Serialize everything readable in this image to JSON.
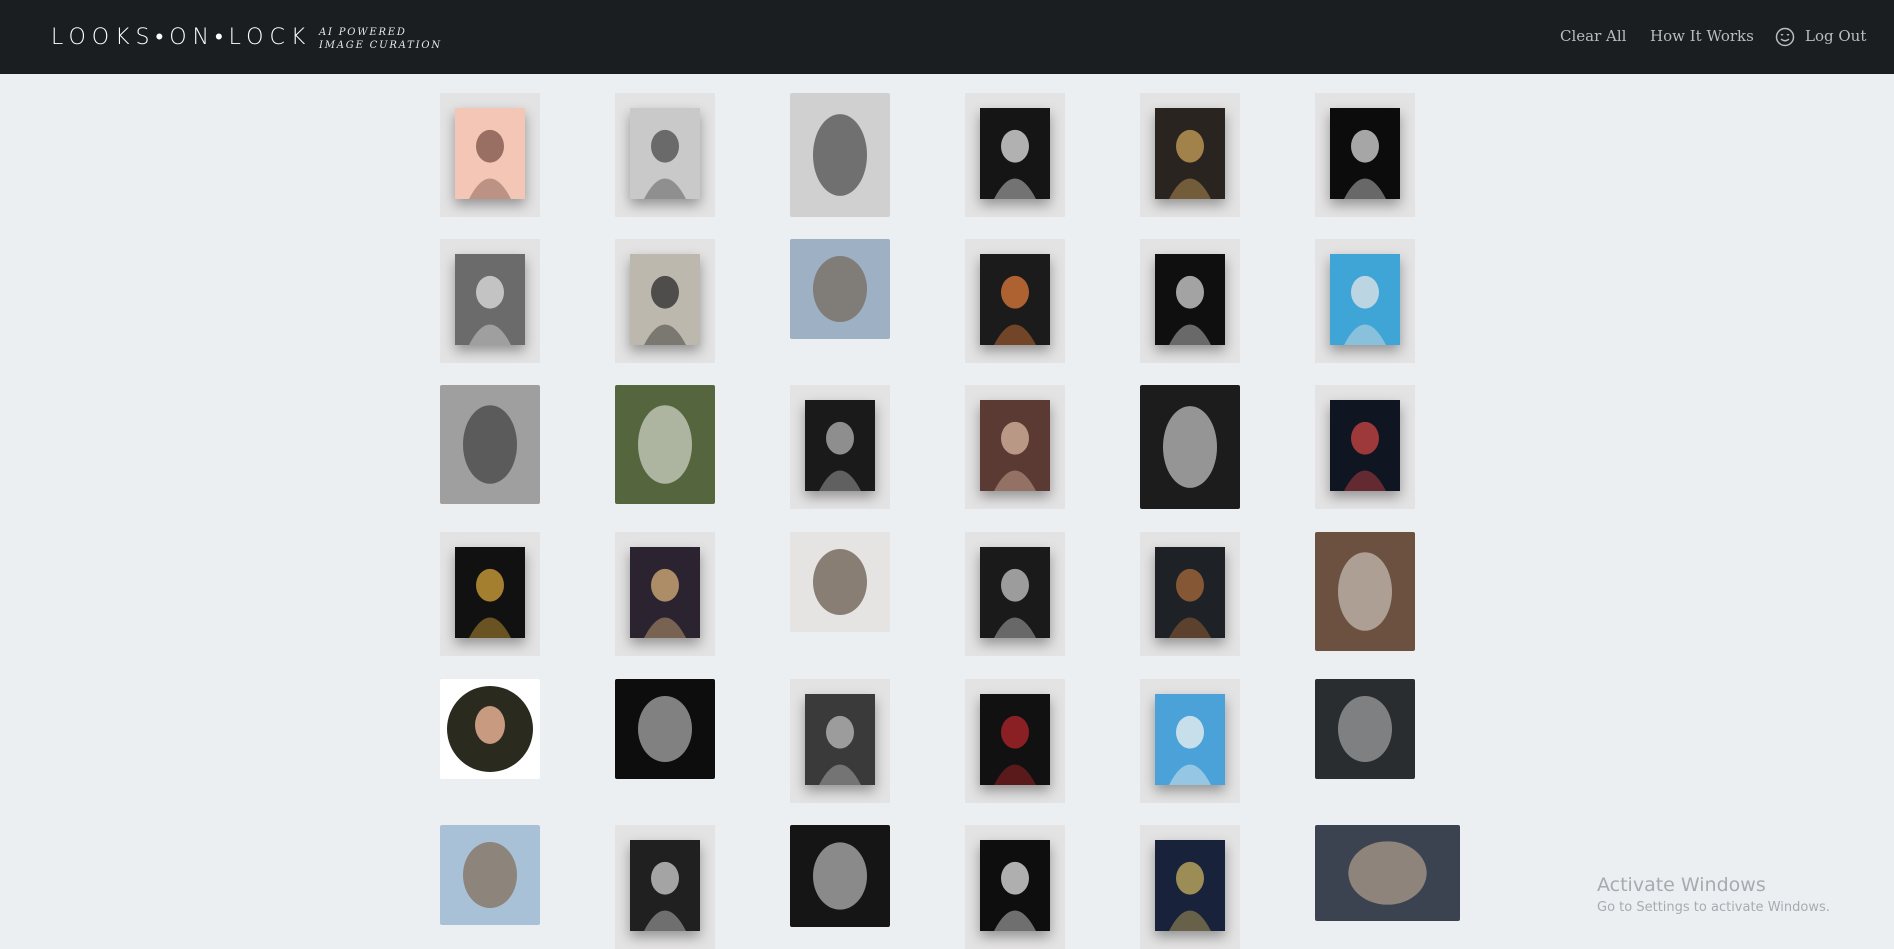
{
  "header": {
    "brand": "LOOKS•ON•LOCK",
    "tagline_line1": "AI POWERED",
    "tagline_line2": "IMAGE CURATION",
    "nav": {
      "clear_all": "Clear All",
      "how_it_works": "How It Works",
      "log_out": "Log Out"
    },
    "logout_icon": "smiley-face-icon"
  },
  "gallery": {
    "rows": [
      [
        {
          "name": "poster-pink-hand",
          "style": "card",
          "bg": "#f3c6b6",
          "accent": "#7a5146"
        },
        {
          "name": "poster-gray-hand-dispersion",
          "style": "card",
          "bg": "#c9c9c9",
          "accent": "#4a4a4a"
        },
        {
          "name": "poster-light-hand-dispersion",
          "style": "full",
          "bg": "#d0d0d0",
          "accent": "#303030"
        },
        {
          "name": "poster-dark-portrait-text",
          "style": "card",
          "bg": "#151515",
          "accent": "#e6e6e6"
        },
        {
          "name": "poster-man-light-streak",
          "style": "card",
          "bg": "#2a2420",
          "accent": "#c9a15a"
        },
        {
          "name": "poster-dark-face-circle",
          "style": "card",
          "bg": "#0c0c0c",
          "accent": "#d9d9d9"
        }
      ],
      [
        {
          "name": "poster-bw-man-mask",
          "style": "card",
          "bg": "#6b6b6b",
          "accent": "#e0e0e0"
        },
        {
          "name": "poster-statue-color-bars",
          "style": "card",
          "bg": "#bdb8ae",
          "accent": "#2a2a2a"
        },
        {
          "name": "photo-deer-sky",
          "style": "full",
          "bg": "#9db0c4",
          "accent": "#6d5a45"
        },
        {
          "name": "poster-statue-rainbow",
          "style": "card",
          "bg": "#1b1b1b",
          "accent": "#e07a3a"
        },
        {
          "name": "poster-black-text",
          "style": "card",
          "bg": "#0f0f0f",
          "accent": "#d6d6d6"
        },
        {
          "name": "poster-blue-statue",
          "style": "card",
          "bg": "#3ea5d6",
          "accent": "#e5e5e5"
        }
      ],
      [
        {
          "name": "photo-hooded-figure-gray",
          "style": "full",
          "bg": "#9f9f9f",
          "accent": "#2e2e2e"
        },
        {
          "name": "photo-white-cockatoo",
          "style": "full",
          "bg": "#55663f",
          "accent": "#e8e8e0"
        },
        {
          "name": "poster-dark-skull-face",
          "style": "card",
          "bg": "#1a1a1a",
          "accent": "#b5b5b5"
        },
        {
          "name": "poster-woman-red-hair",
          "style": "card",
          "bg": "#5a3a32",
          "accent": "#d9b8a3"
        },
        {
          "name": "photo-man-white-shirt-clouds",
          "style": "full",
          "bg": "#1c1c1c",
          "accent": "#e6e6e6"
        },
        {
          "name": "poster-dark-red-glow",
          "style": "card",
          "bg": "#101522",
          "accent": "#c44"
        }
      ],
      [
        {
          "name": "poster-give-rainbow-man",
          "style": "card",
          "bg": "#111",
          "accent": "#d6a43a"
        },
        {
          "name": "poster-phone-galaxy",
          "style": "card",
          "bg": "#2b2430",
          "accent": "#d8b07a"
        },
        {
          "name": "photo-deer-white",
          "style": "full",
          "bg": "#e6e4e2",
          "accent": "#4b3a2c"
        },
        {
          "name": "poster-woman-clouds",
          "style": "card",
          "bg": "#1a1a1a",
          "accent": "#c8c8c8"
        },
        {
          "name": "poster-man-standing-text",
          "style": "card",
          "bg": "#1e2226",
          "accent": "#a86a3a"
        },
        {
          "name": "photo-bison-snow",
          "style": "full",
          "bg": "#6c5140",
          "accent": "#d9d3cc"
        }
      ],
      [
        {
          "name": "photo-man-glasses-circle",
          "style": "full",
          "bg": "#ffffff",
          "accent": "#2b2a1e"
        },
        {
          "name": "photo-bust-statue",
          "style": "full",
          "bg": "#0d0d0d",
          "accent": "#cfcfcf"
        },
        {
          "name": "poster-man-hoodie",
          "style": "card",
          "bg": "#3a3a3a",
          "accent": "#bdbdbd"
        },
        {
          "name": "poster-dark-red-flame",
          "style": "card",
          "bg": "#111",
          "accent": "#b3262a"
        },
        {
          "name": "poster-blue-statue-letters",
          "style": "card",
          "bg": "#4aa2d8",
          "accent": "#f2f2f2"
        },
        {
          "name": "photo-car-mirror",
          "style": "full",
          "bg": "#2a2d30",
          "accent": "#b8b8b8"
        }
      ],
      [
        {
          "name": "photo-deer-blue-sky",
          "style": "full",
          "bg": "#a9c1d6",
          "accent": "#7b5b3f"
        },
        {
          "name": "poster-face-floral-mask",
          "style": "card",
          "bg": "#202020",
          "accent": "#d0d0d0"
        },
        {
          "name": "poster-face-clouds-dark",
          "style": "full",
          "bg": "#151515",
          "accent": "#d9d9d9"
        },
        {
          "name": "poster-you-make-text",
          "style": "card",
          "bg": "#0e0e0e",
          "accent": "#e6e6e6"
        },
        {
          "name": "poster-galaxy-face",
          "style": "card",
          "bg": "#18223a",
          "accent": "#c8b060"
        },
        {
          "name": "photo-woman-street",
          "style": "full",
          "bg": "#3c4350",
          "accent": "#c6b19a"
        }
      ]
    ]
  },
  "watermark": {
    "title": "Activate Windows",
    "subtitle": "Go to Settings to activate Windows."
  }
}
